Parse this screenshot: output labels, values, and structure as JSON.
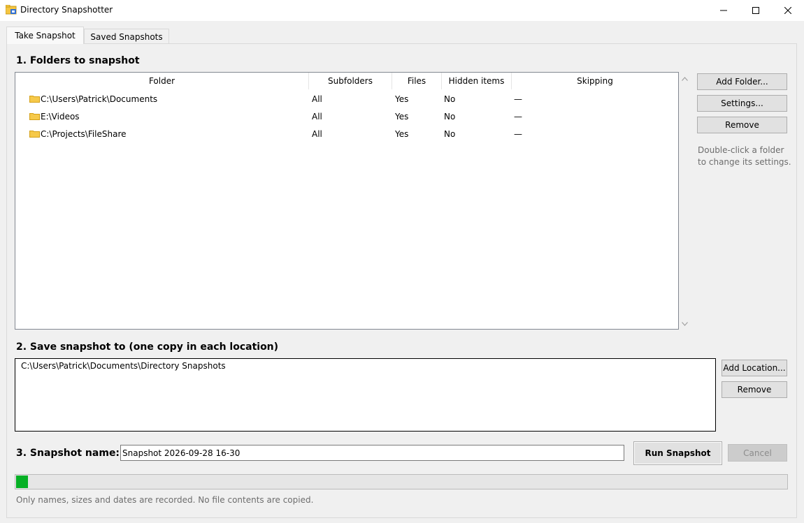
{
  "window": {
    "title": "Directory Snapshotter",
    "controls": {
      "minimize": "—",
      "maximize": "☐",
      "close": "✕"
    }
  },
  "tabs": [
    {
      "label": "Take Snapshot",
      "selected": true
    },
    {
      "label": "Saved Snapshots",
      "selected": false
    }
  ],
  "folders_section": {
    "title": "1. Folders to snapshot",
    "columns": [
      "Folder",
      "Subfolders",
      "Files",
      "Hidden items",
      "Skipping"
    ],
    "rows": [
      {
        "folder": "C:\\Users\\Patrick\\Documents",
        "subfolders": "All",
        "files": "Yes",
        "hidden": "No",
        "skipping": "—"
      },
      {
        "folder": "E:\\Videos",
        "subfolders": "All",
        "files": "Yes",
        "hidden": "No",
        "skipping": "—"
      },
      {
        "folder": "C:\\Projects\\FileShare",
        "subfolders": "All",
        "files": "Yes",
        "hidden": "No",
        "skipping": "—"
      }
    ],
    "buttons": {
      "add_folder": "Add Folder...",
      "settings": "Settings...",
      "remove": "Remove"
    },
    "hint_line1": "Double-click a folder",
    "hint_line2": "to change its settings."
  },
  "save_section": {
    "title": "2. Save snapshot to (one copy in each location)",
    "locations": [
      "C:\\Users\\Patrick\\Documents\\Directory Snapshots"
    ],
    "buttons": {
      "add_location": "Add Location...",
      "remove": "Remove"
    }
  },
  "name_section": {
    "label": "3. Snapshot name:",
    "value": "Snapshot 2026-09-28 16-30",
    "run_label": "Run Snapshot",
    "cancel_label": "Cancel"
  },
  "progress": {
    "percent": 1.5,
    "color": "#06b025"
  },
  "footer_note": "Only names, sizes and dates are recorded. No file contents are copied.",
  "icons": {
    "folder": "folder-icon",
    "scroll_up": "scroll-up-arrow-icon",
    "scroll_down": "scroll-down-arrow-icon"
  }
}
